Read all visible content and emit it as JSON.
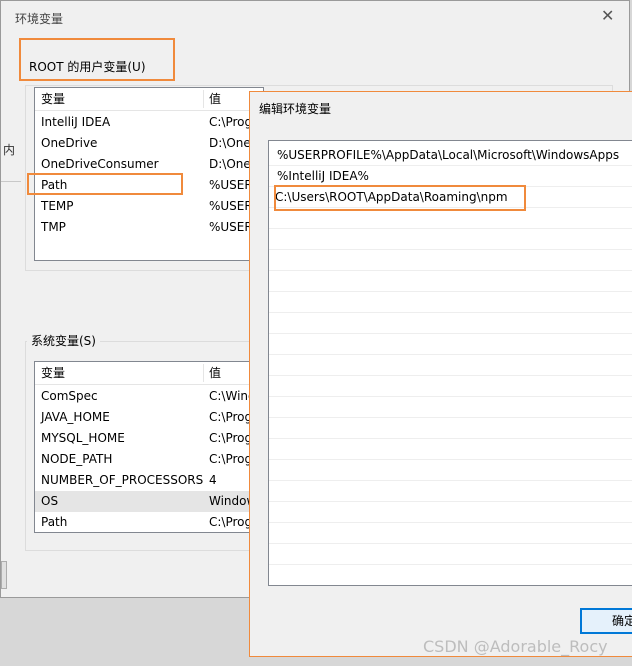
{
  "env_window": {
    "title": "环境变量",
    "user_group_label": "ROOT 的用户变量(U)",
    "user_headers": [
      "变量",
      "值"
    ],
    "user_vars": [
      {
        "name": "IntelliJ IDEA",
        "value": "C:\\Prog"
      },
      {
        "name": "OneDrive",
        "value": "D:\\One"
      },
      {
        "name": "OneDriveConsumer",
        "value": "D:\\One"
      },
      {
        "name": "Path",
        "value": "%USER"
      },
      {
        "name": "TEMP",
        "value": "%USER"
      },
      {
        "name": "TMP",
        "value": "%USER"
      }
    ],
    "side_fragment": "内",
    "system_group_label": "系统变量(S)",
    "system_headers": [
      "变量",
      "值"
    ],
    "system_vars": [
      {
        "name": "ComSpec",
        "value": "C:\\Wind"
      },
      {
        "name": "JAVA_HOME",
        "value": "C:\\Prog"
      },
      {
        "name": "MYSQL_HOME",
        "value": "C:\\Prog"
      },
      {
        "name": "NODE_PATH",
        "value": "C:\\Prog"
      },
      {
        "name": "NUMBER_OF_PROCESSORS",
        "value": "4"
      },
      {
        "name": "OS",
        "value": "Window"
      },
      {
        "name": "Path",
        "value": "C:\\Prog"
      }
    ]
  },
  "edit_dialog": {
    "title": "编辑环境变量",
    "entries": [
      "%USERPROFILE%\\AppData\\Local\\Microsoft\\WindowsApps",
      "%IntelliJ IDEA%",
      "C:\\Users\\ROOT\\AppData\\Roaming\\npm"
    ],
    "ok_label": "确定"
  },
  "watermark": "CSDN @Adorable_Rocy",
  "colors": {
    "highlight": "#f08a3c",
    "accent": "#0078d7"
  }
}
